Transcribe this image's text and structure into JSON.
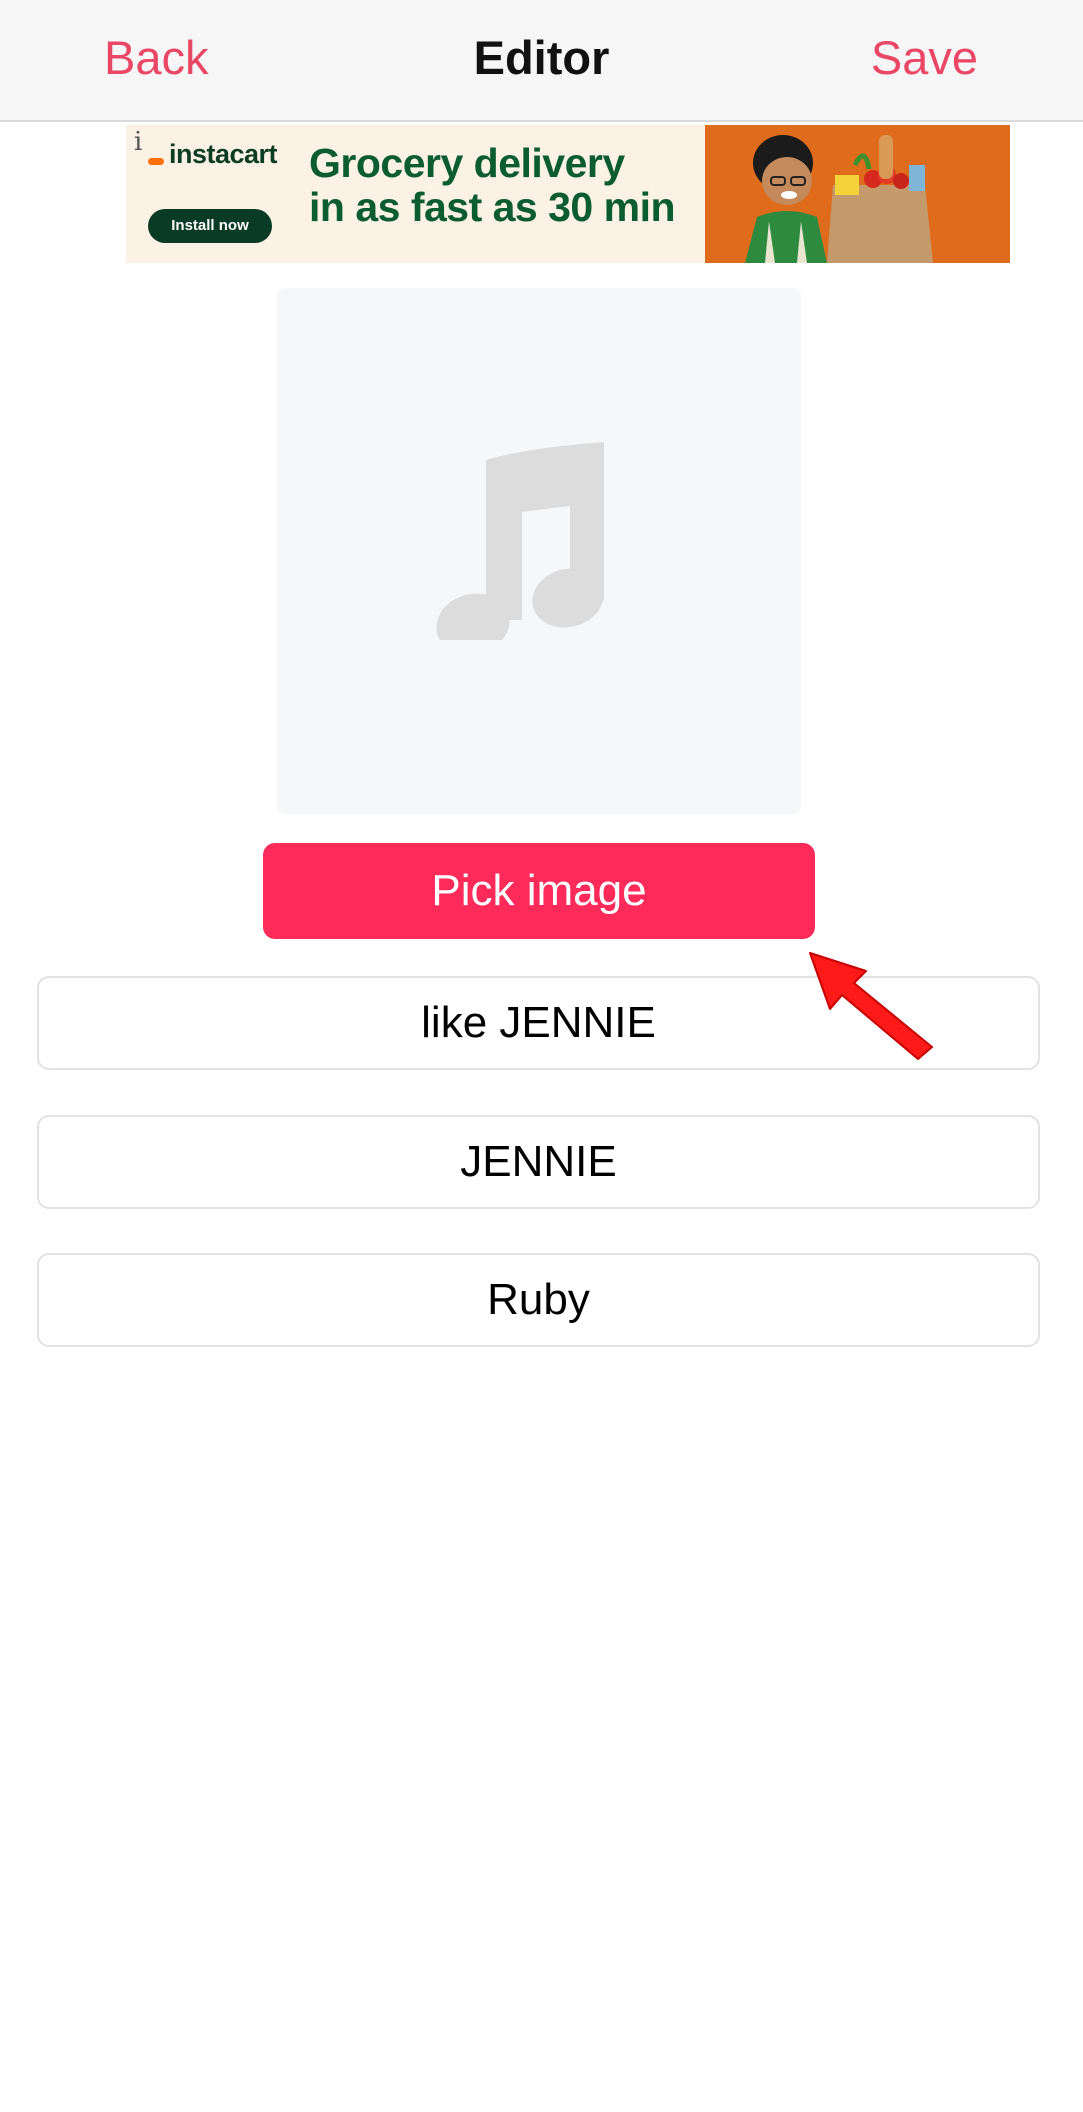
{
  "navbar": {
    "back_label": "Back",
    "title": "Editor",
    "save_label": "Save"
  },
  "ad": {
    "info_glyph": "i",
    "logo_text": "instacart",
    "install_label": "Install now",
    "headline_line1": "Grocery delivery",
    "headline_line2": "in as fast as 30 min"
  },
  "artwork": {
    "icon": "music-note-icon"
  },
  "pick_image": {
    "label": "Pick image"
  },
  "fields": [
    {
      "value": "like JENNIE"
    },
    {
      "value": "JENNIE"
    },
    {
      "value": "Ruby"
    }
  ],
  "colors": {
    "accent": "#ea4766",
    "button": "#fe2b5a",
    "annotation_arrow": "#ff1a1a"
  }
}
